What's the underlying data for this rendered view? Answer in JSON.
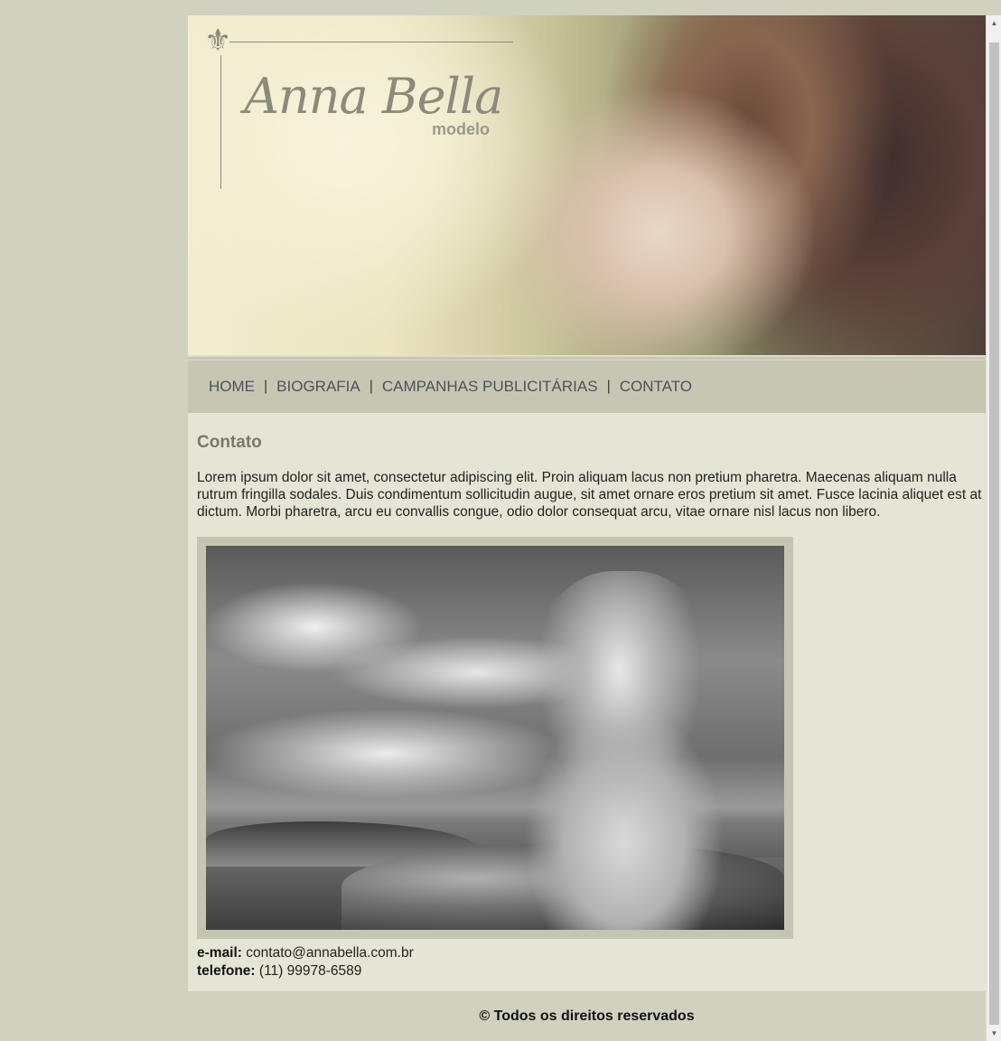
{
  "header": {
    "logo_name": "Anna Bella",
    "logo_sub": "modelo"
  },
  "nav": {
    "items": [
      {
        "label": "HOME"
      },
      {
        "label": "BIOGRAFIA"
      },
      {
        "label": "CAMPANHAS PUBLICITÁRIAS"
      },
      {
        "label": "CONTATO"
      }
    ],
    "separator": "|"
  },
  "main": {
    "title": "Contato",
    "paragraph": "Lorem ipsum dolor sit amet, consectetur adipiscing elit. Proin aliquam lacus non pretium pharetra. Maecenas aliquam nulla rutrum fringilla sodales. Duis condimentum sollicitudin augue, sit amet ornare eros pretium sit amet. Fusce lacinia aliquet est at dictum. Morbi pharetra, arcu eu convallis congue, odio dolor consequat arcu, vitae ornare nisl lacus non libero.",
    "email_label": "e-mail:",
    "email_value": "contato@annabella.com.br",
    "phone_label": "telefone:",
    "phone_value": "(11) 99978-6589"
  },
  "footer": {
    "text": "© Todos os direitos reservados"
  },
  "colors": {
    "page_bg": "#d1d1c0",
    "nav_bg": "#c7c6b2",
    "content_bg": "#e5e5d6",
    "nav_link": "#4c5260",
    "title": "#7a7a6a"
  },
  "icons": {
    "logo_ornament": "fleur-de-lis-icon"
  }
}
